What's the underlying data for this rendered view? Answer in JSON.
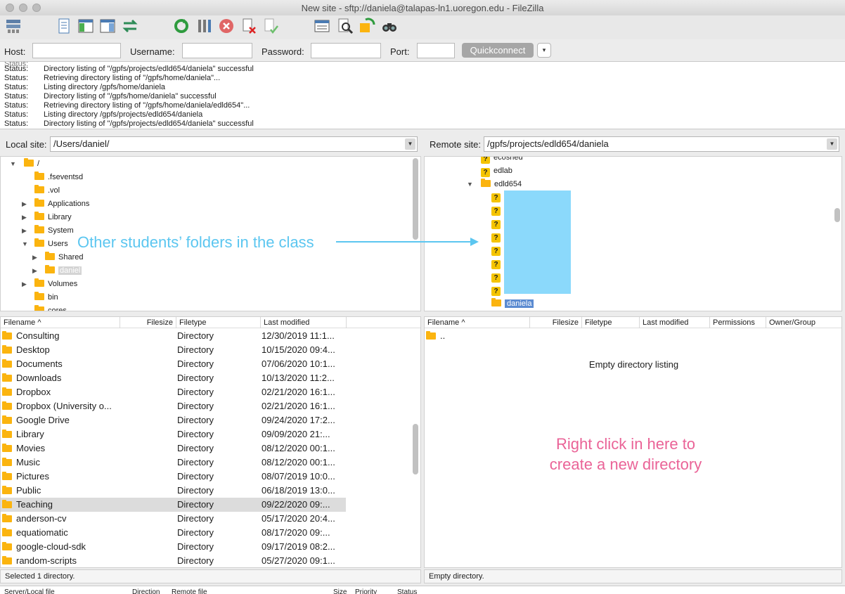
{
  "window": {
    "title": "New site - sftp://daniela@talapas-ln1.uoregon.edu - FileZilla"
  },
  "toolbar": {
    "icons": [
      "site-manager-icon",
      "toggle-log-icon",
      "toggle-local-tree-icon",
      "toggle-remote-tree-icon",
      "sync-browsing-icon",
      "refresh-icon",
      "process-queue-icon",
      "cancel-icon",
      "disconnect-icon",
      "reconnect-icon",
      "filter-icon",
      "compare-icon",
      "toggle-sync-icon",
      "search-icon"
    ]
  },
  "quickconnect": {
    "host_label": "Host:",
    "host_value": "",
    "username_label": "Username:",
    "username_value": "",
    "password_label": "Password:",
    "password_value": "",
    "port_label": "Port:",
    "port_value": "",
    "button": "Quickconnect",
    "dropdown": "▾"
  },
  "log": [
    {
      "k": "Status:",
      "v": "Directory listing of \"/gpfs/projects/edld654/daniela\" successful"
    },
    {
      "k": "Status:",
      "v": "Retrieving directory listing of \"/gpfs/home/daniela\"..."
    },
    {
      "k": "Status:",
      "v": "Listing directory /gpfs/home/daniela"
    },
    {
      "k": "Status:",
      "v": "Directory listing of \"/gpfs/home/daniela\" successful"
    },
    {
      "k": "Status:",
      "v": "Retrieving directory listing of \"/gpfs/home/daniela/edld654\"..."
    },
    {
      "k": "Status:",
      "v": "Listing directory /gpfs/projects/edld654/daniela"
    },
    {
      "k": "Status:",
      "v": "Directory listing of \"/gpfs/projects/edld654/daniela\" successful"
    }
  ],
  "local": {
    "site_label": "Local site:",
    "site_value": "/Users/daniel/",
    "tree": [
      {
        "label": "/",
        "expander": "▼"
      },
      {
        "label": ".fseventsd",
        "expander": ""
      },
      {
        "label": ".vol",
        "expander": ""
      },
      {
        "label": "Applications",
        "expander": "▶"
      },
      {
        "label": "Library",
        "expander": "▶"
      },
      {
        "label": "System",
        "expander": "▶"
      },
      {
        "label": "Users",
        "expander": "▼"
      },
      {
        "label": "Shared",
        "expander": "▶"
      },
      {
        "label": "daniel",
        "expander": "▶"
      },
      {
        "label": "Volumes",
        "expander": "▶"
      },
      {
        "label": "bin",
        "expander": ""
      },
      {
        "label": "cores",
        "expander": ""
      }
    ],
    "columns": [
      "Filename",
      "Filesize",
      "Filetype",
      "Last modified"
    ],
    "sort_arrow": "^",
    "files": [
      {
        "name": "Consulting",
        "type": "Directory",
        "modified": "12/30/2019 11:1..."
      },
      {
        "name": "Desktop",
        "type": "Directory",
        "modified": "10/15/2020 09:4..."
      },
      {
        "name": "Documents",
        "type": "Directory",
        "modified": "07/06/2020 10:1..."
      },
      {
        "name": "Downloads",
        "type": "Directory",
        "modified": "10/13/2020 11:2..."
      },
      {
        "name": "Dropbox",
        "type": "Directory",
        "modified": "02/21/2020 16:1..."
      },
      {
        "name": "Dropbox (University o...",
        "type": "Directory",
        "modified": "02/21/2020 16:1..."
      },
      {
        "name": "Google Drive",
        "type": "Directory",
        "modified": "09/24/2020 17:2..."
      },
      {
        "name": "Library",
        "type": "Directory",
        "modified": "09/09/2020 21:..."
      },
      {
        "name": "Movies",
        "type": "Directory",
        "modified": "08/12/2020 00:1..."
      },
      {
        "name": "Music",
        "type": "Directory",
        "modified": "08/12/2020 00:1..."
      },
      {
        "name": "Pictures",
        "type": "Directory",
        "modified": "08/07/2019 10:0..."
      },
      {
        "name": "Public",
        "type": "Directory",
        "modified": "06/18/2019 13:0..."
      },
      {
        "name": "Teaching",
        "type": "Directory",
        "modified": "09/22/2020 09:..."
      },
      {
        "name": "anderson-cv",
        "type": "Directory",
        "modified": "05/17/2020 20:4..."
      },
      {
        "name": "equatiomatic",
        "type": "Directory",
        "modified": "08/17/2020 09:..."
      },
      {
        "name": "google-cloud-sdk",
        "type": "Directory",
        "modified": "09/17/2019 08:2..."
      },
      {
        "name": "random-scripts",
        "type": "Directory",
        "modified": "05/27/2020 09:1..."
      }
    ],
    "status": "Selected 1 directory."
  },
  "remote": {
    "site_label": "Remote site:",
    "site_value": "/gpfs/projects/edld654/daniela",
    "tree": [
      {
        "label": "ecoshed",
        "icon": "?"
      },
      {
        "label": "edlab",
        "icon": "?"
      },
      {
        "label": "edld654",
        "icon": "folder",
        "expander": "▼"
      },
      {
        "label": "daniela",
        "icon": "folder"
      }
    ],
    "hidden_entries": [
      "?",
      "?",
      "?",
      "?",
      "?",
      "?",
      "?",
      "?"
    ],
    "columns": [
      "Filename",
      "Filesize",
      "Filetype",
      "Last modified",
      "Permissions",
      "Owner/Group"
    ],
    "sort_arrow": "^",
    "files": [
      {
        "name": ".."
      }
    ],
    "empty_message": "Empty directory listing",
    "status": "Empty directory."
  },
  "queue": {
    "columns": [
      "Server/Local file",
      "Direction",
      "Remote file",
      "Size",
      "Priority",
      "Status"
    ]
  },
  "annotations": {
    "students": "Other students’ folders in the class",
    "right_click": "Right click in here to create a new directory"
  },
  "colors": {
    "folder": "#fbb40f",
    "annotation_blue": "#5bc6f0",
    "annotation_pink": "#ea6397",
    "redaction": "#8bd9fb",
    "selection": "#5b8bd1"
  }
}
